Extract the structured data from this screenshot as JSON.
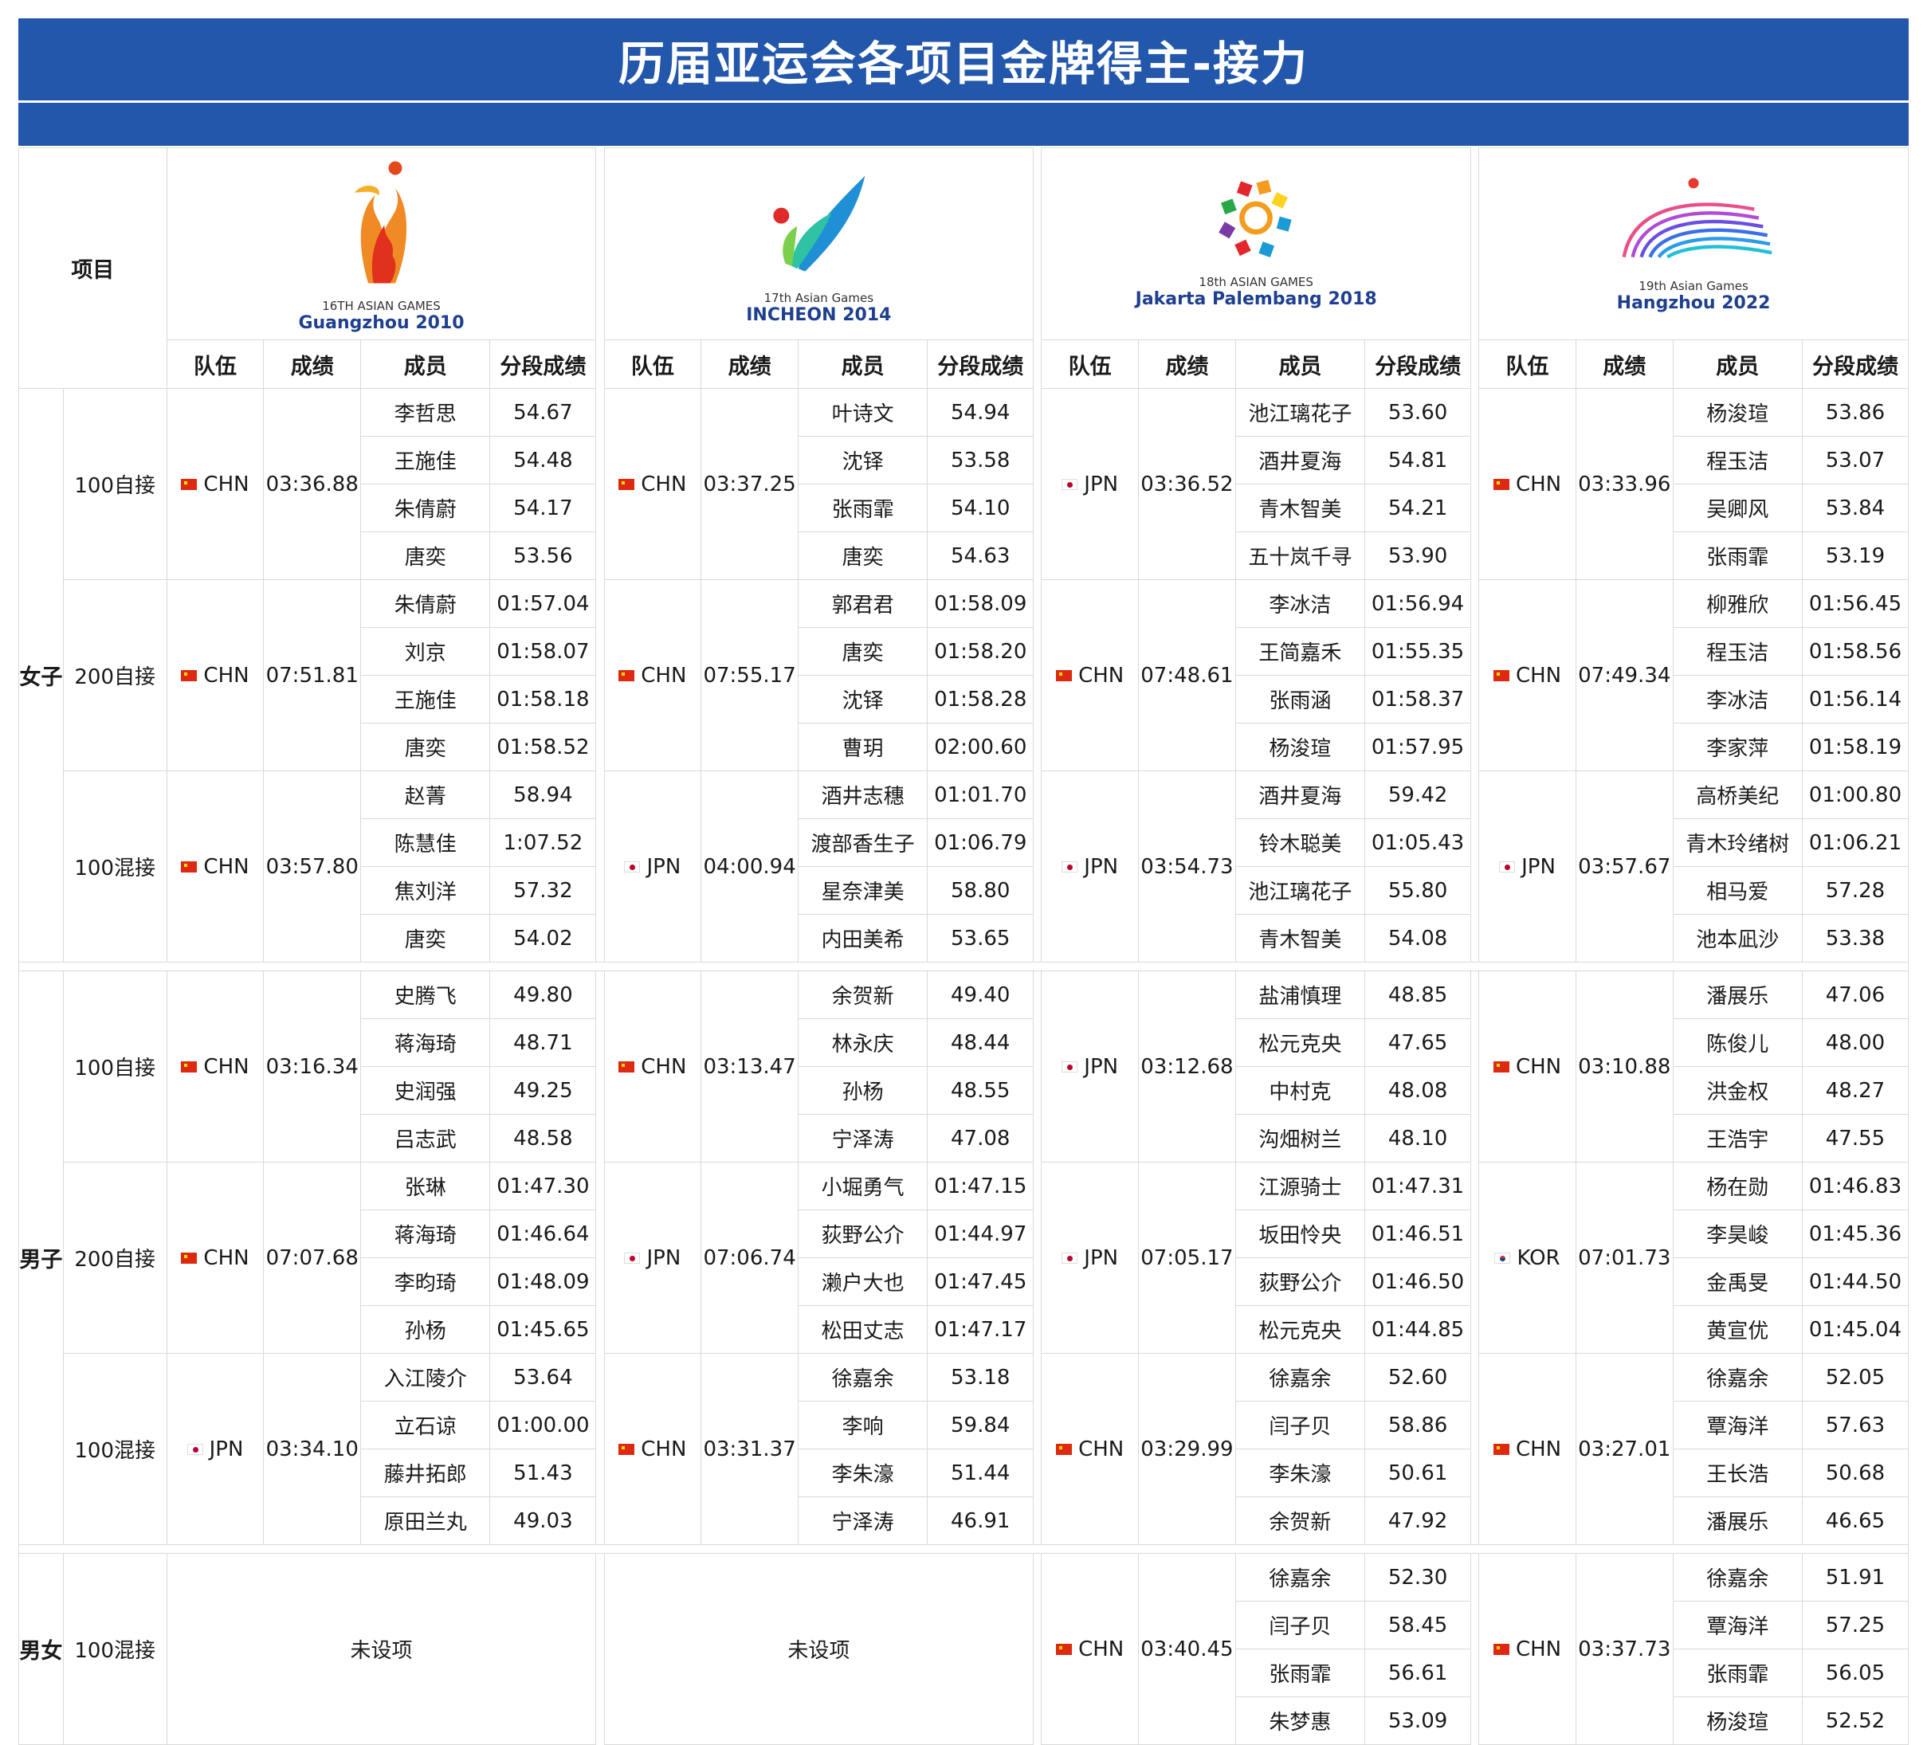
{
  "title": "历届亚运会各项目金牌得主-接力",
  "header": {
    "item_label": "项目",
    "col_team": "队伍",
    "col_time": "成绩",
    "col_member": "成员",
    "col_split": "分段成绩"
  },
  "games": [
    {
      "caption": "16TH ASIAN GAMES",
      "name": "Guangzhou 2010",
      "logo_icon": "guangzhou-2010-flame-logo"
    },
    {
      "caption": "17th Asian Games",
      "name": "INCHEON 2014",
      "logo_icon": "incheon-2014-wing-logo"
    },
    {
      "caption": "18th ASIAN GAMES",
      "name": "Jakarta Palembang 2018",
      "logo_icon": "jakarta-2018-gelora-logo"
    },
    {
      "caption": "19th Asian Games",
      "name": "Hangzhou 2022",
      "logo_icon": "hangzhou-2022-tide-logo"
    }
  ],
  "groups": [
    {
      "gender": "女子",
      "events": [
        {
          "event": "100自接",
          "results": [
            {
              "team": "CHN",
              "flag": "chn",
              "time": "03:36.88",
              "members": [
                [
                  "李哲思",
                  "54.67"
                ],
                [
                  "王施佳",
                  "54.48"
                ],
                [
                  "朱倩蔚",
                  "54.17"
                ],
                [
                  "唐奕",
                  "53.56"
                ]
              ]
            },
            {
              "team": "CHN",
              "flag": "chn",
              "time": "03:37.25",
              "members": [
                [
                  "叶诗文",
                  "54.94"
                ],
                [
                  "沈铎",
                  "53.58"
                ],
                [
                  "张雨霏",
                  "54.10"
                ],
                [
                  "唐奕",
                  "54.63"
                ]
              ]
            },
            {
              "team": "JPN",
              "flag": "jpn",
              "time": "03:36.52",
              "members": [
                [
                  "池江璃花子",
                  "53.60"
                ],
                [
                  "酒井夏海",
                  "54.81"
                ],
                [
                  "青木智美",
                  "54.21"
                ],
                [
                  "五十岚千寻",
                  "53.90"
                ]
              ]
            },
            {
              "team": "CHN",
              "flag": "chn",
              "time": "03:33.96",
              "members": [
                [
                  "杨浚瑄",
                  "53.86"
                ],
                [
                  "程玉洁",
                  "53.07"
                ],
                [
                  "吴卿风",
                  "53.84"
                ],
                [
                  "张雨霏",
                  "53.19"
                ]
              ]
            }
          ]
        },
        {
          "event": "200自接",
          "results": [
            {
              "team": "CHN",
              "flag": "chn",
              "time": "07:51.81",
              "members": [
                [
                  "朱倩蔚",
                  "01:57.04"
                ],
                [
                  "刘京",
                  "01:58.07"
                ],
                [
                  "王施佳",
                  "01:58.18"
                ],
                [
                  "唐奕",
                  "01:58.52"
                ]
              ]
            },
            {
              "team": "CHN",
              "flag": "chn",
              "time": "07:55.17",
              "members": [
                [
                  "郭君君",
                  "01:58.09"
                ],
                [
                  "唐奕",
                  "01:58.20"
                ],
                [
                  "沈铎",
                  "01:58.28"
                ],
                [
                  "曹玥",
                  "02:00.60"
                ]
              ]
            },
            {
              "team": "CHN",
              "flag": "chn",
              "time": "07:48.61",
              "members": [
                [
                  "李冰洁",
                  "01:56.94"
                ],
                [
                  "王简嘉禾",
                  "01:55.35"
                ],
                [
                  "张雨涵",
                  "01:58.37"
                ],
                [
                  "杨浚瑄",
                  "01:57.95"
                ]
              ]
            },
            {
              "team": "CHN",
              "flag": "chn",
              "time": "07:49.34",
              "members": [
                [
                  "柳雅欣",
                  "01:56.45"
                ],
                [
                  "程玉洁",
                  "01:58.56"
                ],
                [
                  "李冰洁",
                  "01:56.14"
                ],
                [
                  "李家萍",
                  "01:58.19"
                ]
              ]
            }
          ]
        },
        {
          "event": "100混接",
          "results": [
            {
              "team": "CHN",
              "flag": "chn",
              "time": "03:57.80",
              "members": [
                [
                  "赵菁",
                  "58.94"
                ],
                [
                  "陈慧佳",
                  "1:07.52"
                ],
                [
                  "焦刘洋",
                  "57.32"
                ],
                [
                  "唐奕",
                  "54.02"
                ]
              ]
            },
            {
              "team": "JPN",
              "flag": "jpn",
              "time": "04:00.94",
              "members": [
                [
                  "酒井志穗",
                  "01:01.70"
                ],
                [
                  "渡部香生子",
                  "01:06.79"
                ],
                [
                  "星奈津美",
                  "58.80"
                ],
                [
                  "内田美希",
                  "53.65"
                ]
              ]
            },
            {
              "team": "JPN",
              "flag": "jpn",
              "time": "03:54.73",
              "members": [
                [
                  "酒井夏海",
                  "59.42"
                ],
                [
                  "铃木聪美",
                  "01:05.43"
                ],
                [
                  "池江璃花子",
                  "55.80"
                ],
                [
                  "青木智美",
                  "54.08"
                ]
              ]
            },
            {
              "team": "JPN",
              "flag": "jpn",
              "time": "03:57.67",
              "members": [
                [
                  "高桥美纪",
                  "01:00.80"
                ],
                [
                  "青木玲绪树",
                  "01:06.21"
                ],
                [
                  "相马爱",
                  "57.28"
                ],
                [
                  "池本凪沙",
                  "53.38"
                ]
              ]
            }
          ]
        }
      ]
    },
    {
      "gender": "男子",
      "events": [
        {
          "event": "100自接",
          "results": [
            {
              "team": "CHN",
              "flag": "chn",
              "time": "03:16.34",
              "members": [
                [
                  "史腾飞",
                  "49.80"
                ],
                [
                  "蒋海琦",
                  "48.71"
                ],
                [
                  "史润强",
                  "49.25"
                ],
                [
                  "吕志武",
                  "48.58"
                ]
              ]
            },
            {
              "team": "CHN",
              "flag": "chn",
              "time": "03:13.47",
              "members": [
                [
                  "余贺新",
                  "49.40"
                ],
                [
                  "林永庆",
                  "48.44"
                ],
                [
                  "孙杨",
                  "48.55"
                ],
                [
                  "宁泽涛",
                  "47.08"
                ]
              ]
            },
            {
              "team": "JPN",
              "flag": "jpn",
              "time": "03:12.68",
              "members": [
                [
                  "盐浦慎理",
                  "48.85"
                ],
                [
                  "松元克央",
                  "47.65"
                ],
                [
                  "中村克",
                  "48.08"
                ],
                [
                  "沟畑树兰",
                  "48.10"
                ]
              ]
            },
            {
              "team": "CHN",
              "flag": "chn",
              "time": "03:10.88",
              "members": [
                [
                  "潘展乐",
                  "47.06"
                ],
                [
                  "陈俊儿",
                  "48.00"
                ],
                [
                  "洪金权",
                  "48.27"
                ],
                [
                  "王浩宇",
                  "47.55"
                ]
              ]
            }
          ]
        },
        {
          "event": "200自接",
          "results": [
            {
              "team": "CHN",
              "flag": "chn",
              "time": "07:07.68",
              "members": [
                [
                  "张琳",
                  "01:47.30"
                ],
                [
                  "蒋海琦",
                  "01:46.64"
                ],
                [
                  "李昀琦",
                  "01:48.09"
                ],
                [
                  "孙杨",
                  "01:45.65"
                ]
              ]
            },
            {
              "team": "JPN",
              "flag": "jpn",
              "time": "07:06.74",
              "members": [
                [
                  "小堀勇气",
                  "01:47.15"
                ],
                [
                  "荻野公介",
                  "01:44.97"
                ],
                [
                  "濑户大也",
                  "01:47.45"
                ],
                [
                  "松田丈志",
                  "01:47.17"
                ]
              ]
            },
            {
              "team": "JPN",
              "flag": "jpn",
              "time": "07:05.17",
              "members": [
                [
                  "江源骑士",
                  "01:47.31"
                ],
                [
                  "坂田怜央",
                  "01:46.51"
                ],
                [
                  "荻野公介",
                  "01:46.50"
                ],
                [
                  "松元克央",
                  "01:44.85"
                ]
              ]
            },
            {
              "team": "KOR",
              "flag": "kor",
              "time": "07:01.73",
              "members": [
                [
                  "杨在勋",
                  "01:46.83"
                ],
                [
                  "李昊峻",
                  "01:45.36"
                ],
                [
                  "金禹旻",
                  "01:44.50"
                ],
                [
                  "黄宣优",
                  "01:45.04"
                ]
              ]
            }
          ]
        },
        {
          "event": "100混接",
          "results": [
            {
              "team": "JPN",
              "flag": "jpn",
              "time": "03:34.10",
              "members": [
                [
                  "入江陵介",
                  "53.64"
                ],
                [
                  "立石谅",
                  "01:00.00"
                ],
                [
                  "藤井拓郎",
                  "51.43"
                ],
                [
                  "原田兰丸",
                  "49.03"
                ]
              ]
            },
            {
              "team": "CHN",
              "flag": "chn",
              "time": "03:31.37",
              "members": [
                [
                  "徐嘉余",
                  "53.18"
                ],
                [
                  "李响",
                  "59.84"
                ],
                [
                  "李朱濠",
                  "51.44"
                ],
                [
                  "宁泽涛",
                  "46.91"
                ]
              ]
            },
            {
              "team": "CHN",
              "flag": "chn",
              "time": "03:29.99",
              "members": [
                [
                  "徐嘉余",
                  "52.60"
                ],
                [
                  "闫子贝",
                  "58.86"
                ],
                [
                  "李朱濠",
                  "50.61"
                ],
                [
                  "余贺新",
                  "47.92"
                ]
              ]
            },
            {
              "team": "CHN",
              "flag": "chn",
              "time": "03:27.01",
              "members": [
                [
                  "徐嘉余",
                  "52.05"
                ],
                [
                  "覃海洋",
                  "57.63"
                ],
                [
                  "王长浩",
                  "50.68"
                ],
                [
                  "潘展乐",
                  "46.65"
                ]
              ]
            }
          ]
        }
      ]
    },
    {
      "gender": "男女",
      "events": [
        {
          "event": "100混接",
          "results": [
            {
              "not_held": "未设项"
            },
            {
              "not_held": "未设项"
            },
            {
              "team": "CHN",
              "flag": "chn",
              "time": "03:40.45",
              "members": [
                [
                  "徐嘉余",
                  "52.30"
                ],
                [
                  "闫子贝",
                  "58.45"
                ],
                [
                  "张雨霏",
                  "56.61"
                ],
                [
                  "朱梦惠",
                  "53.09"
                ]
              ]
            },
            {
              "team": "CHN",
              "flag": "chn",
              "time": "03:37.73",
              "members": [
                [
                  "徐嘉余",
                  "51.91"
                ],
                [
                  "覃海洋",
                  "57.25"
                ],
                [
                  "张雨霏",
                  "56.05"
                ],
                [
                  "杨浚瑄",
                  "52.52"
                ]
              ]
            }
          ]
        }
      ]
    }
  ]
}
